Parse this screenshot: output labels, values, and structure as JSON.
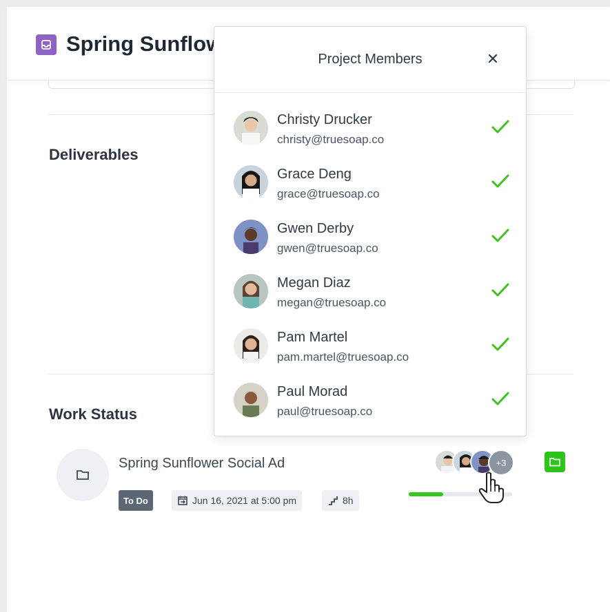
{
  "header": {
    "title": "Spring Sunflower Social Ad",
    "icon": "inbox-icon",
    "icon_color": "#8e63c5"
  },
  "sections": {
    "deliverables": "Deliverables",
    "work_status": "Work Status"
  },
  "task": {
    "name": "Spring Sunflower Social Ad",
    "status": "To Do",
    "due": "Jun 16, 2021 at 5:00 pm",
    "estimate": "8h",
    "extra_members": "+3",
    "progress_percent": 33,
    "accent_color": "#2dc41a"
  },
  "popover": {
    "title": "Project Members",
    "close_label": "×",
    "members": [
      {
        "name": "Christy Drucker",
        "email": "christy@truesoap.co"
      },
      {
        "name": "Grace Deng",
        "email": "grace@truesoap.co"
      },
      {
        "name": "Gwen Derby",
        "email": "gwen@truesoap.co"
      },
      {
        "name": "Megan Diaz",
        "email": "megan@truesoap.co"
      },
      {
        "name": "Pam Martel",
        "email": "pam.martel@truesoap.co"
      },
      {
        "name": "Paul Morad",
        "email": "paul@truesoap.co"
      }
    ],
    "check_color": "#3fc21f"
  }
}
